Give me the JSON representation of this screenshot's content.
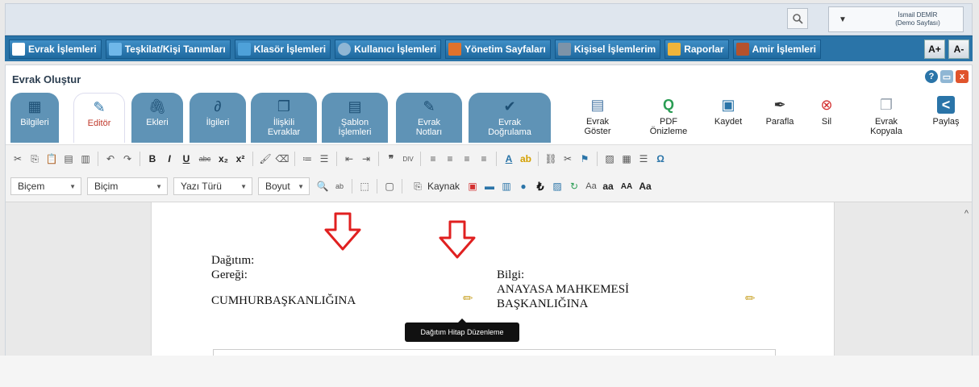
{
  "topbar": {
    "search_icon": "search-icon",
    "user_name": "İsmail DEMİR",
    "user_sub": "(Demo Sayfası)"
  },
  "menu": {
    "items": [
      {
        "label": "Evrak İşlemleri",
        "icon": "document-icon",
        "color": "#ffffff"
      },
      {
        "label": "Teşkilat/Kişi Tanımları",
        "icon": "org-chart-icon",
        "color": "#6fb7e9"
      },
      {
        "label": "Klasör İşlemleri",
        "icon": "folder-icon",
        "color": "#4ea1d9"
      },
      {
        "label": "Kullanıcı İşlemleri",
        "icon": "user-icon",
        "color": "#8fb6d4"
      },
      {
        "label": "Yönetim Sayfaları",
        "icon": "admin-icon",
        "color": "#e0722c"
      },
      {
        "label": "Kişisel İşlemlerim",
        "icon": "personal-icon",
        "color": "#7d93a8"
      },
      {
        "label": "Raporlar",
        "icon": "report-icon",
        "color": "#f0b43a"
      },
      {
        "label": "Amir İşlemleri",
        "icon": "manager-icon",
        "color": "#b4522d"
      }
    ],
    "font_increase": "A+",
    "font_decrease": "A-"
  },
  "panel": {
    "title": "Evrak Oluştur",
    "help_icon": "?",
    "close_icon": "x"
  },
  "tabs": [
    {
      "label": "Bilgileri",
      "icon": "info-icon",
      "glyph": "▦"
    },
    {
      "label": "Editör",
      "icon": "editor-icon",
      "glyph": "✎"
    },
    {
      "label": "Ekleri",
      "icon": "paperclip-icon",
      "glyph": "⌕"
    },
    {
      "label": "İlgileri",
      "icon": "link-icon",
      "glyph": "∂"
    },
    {
      "label": "İlişkili Evraklar",
      "icon": "related-docs-icon",
      "glyph": "❐"
    },
    {
      "label": "Şablon İşlemleri",
      "icon": "template-icon",
      "glyph": "▤"
    },
    {
      "label": "Evrak Notları",
      "icon": "notes-icon",
      "glyph": "✎"
    },
    {
      "label": "Evrak Doğrulama",
      "icon": "verify-icon",
      "glyph": "✔"
    }
  ],
  "actions": [
    {
      "label": "Evrak Göster",
      "icon": "show-doc-icon",
      "glyph": "▤",
      "color": "#4a78a6"
    },
    {
      "label": "PDF Önizleme",
      "icon": "pdf-preview-icon",
      "glyph": "Q",
      "color": "#2a9d54"
    },
    {
      "label": "Kaydet",
      "icon": "save-icon",
      "glyph": "▣",
      "color": "#2a74a8"
    },
    {
      "label": "Parafla",
      "icon": "pen-icon",
      "glyph": "✒",
      "color": "#333333"
    },
    {
      "label": "Sil",
      "icon": "delete-icon",
      "glyph": "⊗",
      "color": "#d32f2f"
    },
    {
      "label": "Evrak Kopyala",
      "icon": "copy-icon",
      "glyph": "❐",
      "color": "#9aa5b1"
    },
    {
      "label": "Paylaş",
      "icon": "share-icon",
      "glyph": "<",
      "color": "#2a74a8"
    }
  ],
  "toolbar": {
    "combos": [
      {
        "label": "Biçem"
      },
      {
        "label": "Biçim"
      },
      {
        "label": "Yazı Türü"
      },
      {
        "label": "Boyut"
      }
    ],
    "kaynak": "Kaynak",
    "row1_bold": "B",
    "row1_italic": "I",
    "row1_underline": "U",
    "row1_strike": "abc",
    "row1_sub": "x₂",
    "row1_sup": "x²",
    "omega": "Ω",
    "size_lower": "aa",
    "size_upper": "AA",
    "size_title": "Aa"
  },
  "document": {
    "dagitim": "Dağıtım:",
    "geregi": "Gereği:",
    "geregi_value": "CUMHURBAŞKANLIĞINA",
    "bilgi": "Bilgi:",
    "bilgi_line1": "ANAYASA MAHKEMESİ",
    "bilgi_line2": "BAŞKANLIĞINA"
  },
  "tooltip": {
    "text": "Dağıtım Hitap Düzenleme"
  },
  "colors": {
    "menu_bg": "#2a74a8",
    "tab_bg": "#5f93b6",
    "active_tab_text": "#c0392b",
    "arrow_red": "#e02020",
    "pencil": "#c9a227"
  }
}
